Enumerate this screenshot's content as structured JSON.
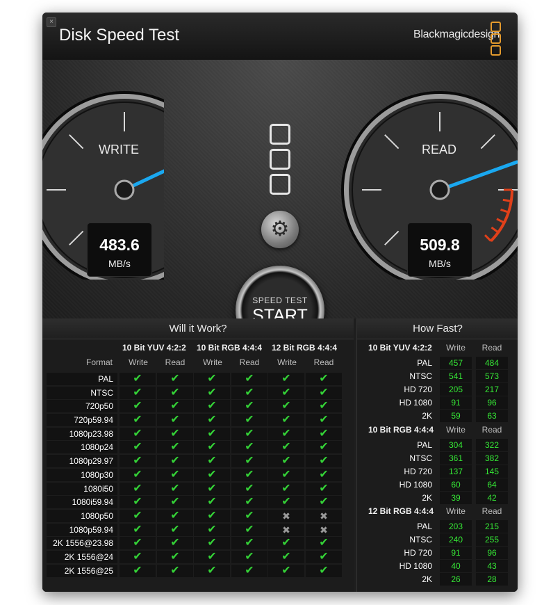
{
  "app": {
    "title": "Disk Speed Test",
    "brand": "Blackmagicdesign",
    "close_glyph": "×"
  },
  "colors": {
    "accent_needle": "#1aa8f0",
    "redline": "#e0401a",
    "ok_green": "#34d237",
    "value_green": "#35e635",
    "logo_orange": "#e59b2d"
  },
  "gauges": {
    "write": {
      "label": "WRITE",
      "value": "483.6",
      "unit": "MB/s",
      "fraction": 0.74
    },
    "read": {
      "label": "READ",
      "value": "509.8",
      "unit": "MB/s",
      "fraction": 0.76
    }
  },
  "controls": {
    "settings_icon": "gear-icon",
    "settings_glyph": "⚙",
    "start_small": "SPEED TEST",
    "start_big": "START"
  },
  "will_it_work": {
    "header": "Will it Work?",
    "format_header": "Format",
    "groups": [
      "10 Bit YUV 4:2:2",
      "10 Bit RGB 4:4:4",
      "12 Bit RGB 4:4:4"
    ],
    "sub_headers": [
      "Write",
      "Read",
      "Write",
      "Read",
      "Write",
      "Read"
    ],
    "ok_glyph": "✔",
    "no_glyph": "✖",
    "rows": [
      {
        "format": "PAL",
        "cells": [
          1,
          1,
          1,
          1,
          1,
          1
        ]
      },
      {
        "format": "NTSC",
        "cells": [
          1,
          1,
          1,
          1,
          1,
          1
        ]
      },
      {
        "format": "720p50",
        "cells": [
          1,
          1,
          1,
          1,
          1,
          1
        ]
      },
      {
        "format": "720p59.94",
        "cells": [
          1,
          1,
          1,
          1,
          1,
          1
        ]
      },
      {
        "format": "1080p23.98",
        "cells": [
          1,
          1,
          1,
          1,
          1,
          1
        ]
      },
      {
        "format": "1080p24",
        "cells": [
          1,
          1,
          1,
          1,
          1,
          1
        ]
      },
      {
        "format": "1080p29.97",
        "cells": [
          1,
          1,
          1,
          1,
          1,
          1
        ]
      },
      {
        "format": "1080p30",
        "cells": [
          1,
          1,
          1,
          1,
          1,
          1
        ]
      },
      {
        "format": "1080i50",
        "cells": [
          1,
          1,
          1,
          1,
          1,
          1
        ]
      },
      {
        "format": "1080i59.94",
        "cells": [
          1,
          1,
          1,
          1,
          1,
          1
        ]
      },
      {
        "format": "1080p50",
        "cells": [
          1,
          1,
          1,
          1,
          0,
          0
        ]
      },
      {
        "format": "1080p59.94",
        "cells": [
          1,
          1,
          1,
          1,
          0,
          0
        ]
      },
      {
        "format": "2K 1556@23.98",
        "cells": [
          1,
          1,
          1,
          1,
          1,
          1
        ]
      },
      {
        "format": "2K 1556@24",
        "cells": [
          1,
          1,
          1,
          1,
          1,
          1
        ]
      },
      {
        "format": "2K 1556@25",
        "cells": [
          1,
          1,
          1,
          1,
          1,
          1
        ]
      }
    ]
  },
  "how_fast": {
    "header": "How Fast?",
    "write_header": "Write",
    "read_header": "Read",
    "groups": [
      {
        "name": "10 Bit YUV 4:2:2",
        "rows": [
          {
            "label": "PAL",
            "write": "457",
            "read": "484"
          },
          {
            "label": "NTSC",
            "write": "541",
            "read": "573"
          },
          {
            "label": "HD 720",
            "write": "205",
            "read": "217"
          },
          {
            "label": "HD 1080",
            "write": "91",
            "read": "96"
          },
          {
            "label": "2K",
            "write": "59",
            "read": "63"
          }
        ]
      },
      {
        "name": "10 Bit RGB 4:4:4",
        "rows": [
          {
            "label": "PAL",
            "write": "304",
            "read": "322"
          },
          {
            "label": "NTSC",
            "write": "361",
            "read": "382"
          },
          {
            "label": "HD 720",
            "write": "137",
            "read": "145"
          },
          {
            "label": "HD 1080",
            "write": "60",
            "read": "64"
          },
          {
            "label": "2K",
            "write": "39",
            "read": "42"
          }
        ]
      },
      {
        "name": "12 Bit RGB 4:4:4",
        "rows": [
          {
            "label": "PAL",
            "write": "203",
            "read": "215"
          },
          {
            "label": "NTSC",
            "write": "240",
            "read": "255"
          },
          {
            "label": "HD 720",
            "write": "91",
            "read": "96"
          },
          {
            "label": "HD 1080",
            "write": "40",
            "read": "43"
          },
          {
            "label": "2K",
            "write": "26",
            "read": "28"
          }
        ]
      }
    ]
  }
}
